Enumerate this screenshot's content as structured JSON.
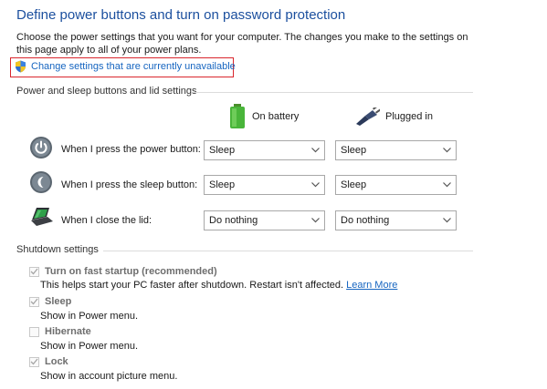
{
  "header": {
    "title": "Define power buttons and turn on password protection",
    "description": "Choose the power settings that you want for your computer. The changes you make to the settings on this page apply to all of your power plans.",
    "change_link": "Change settings that are currently unavailable"
  },
  "power_section": {
    "title": "Power and sleep buttons and lid settings",
    "on_battery": "On battery",
    "plugged_in": "Plugged in",
    "rows": [
      {
        "label": "When I press the power button:",
        "battery": "Sleep",
        "plugged": "Sleep",
        "icon": "power-button-icon"
      },
      {
        "label": "When I press the sleep button:",
        "battery": "Sleep",
        "plugged": "Sleep",
        "icon": "sleep-button-icon"
      },
      {
        "label": "When I close the lid:",
        "battery": "Do nothing",
        "plugged": "Do nothing",
        "icon": "laptop-lid-icon"
      }
    ]
  },
  "shutdown_section": {
    "title": "Shutdown settings",
    "items": [
      {
        "label": "Turn on fast startup (recommended)",
        "checked": true,
        "desc": "This helps start your PC faster after shutdown. Restart isn't affected.",
        "link": "Learn More"
      },
      {
        "label": "Sleep",
        "checked": true,
        "desc": "Show in Power menu."
      },
      {
        "label": "Hibernate",
        "checked": false,
        "desc": "Show in Power menu."
      },
      {
        "label": "Lock",
        "checked": true,
        "desc": "Show in account picture menu."
      }
    ]
  },
  "colors": {
    "title": "#1b4f9e",
    "link": "#1665c0",
    "highlight_box": "#d9262d",
    "disabled_text": "#6e6e6e"
  }
}
